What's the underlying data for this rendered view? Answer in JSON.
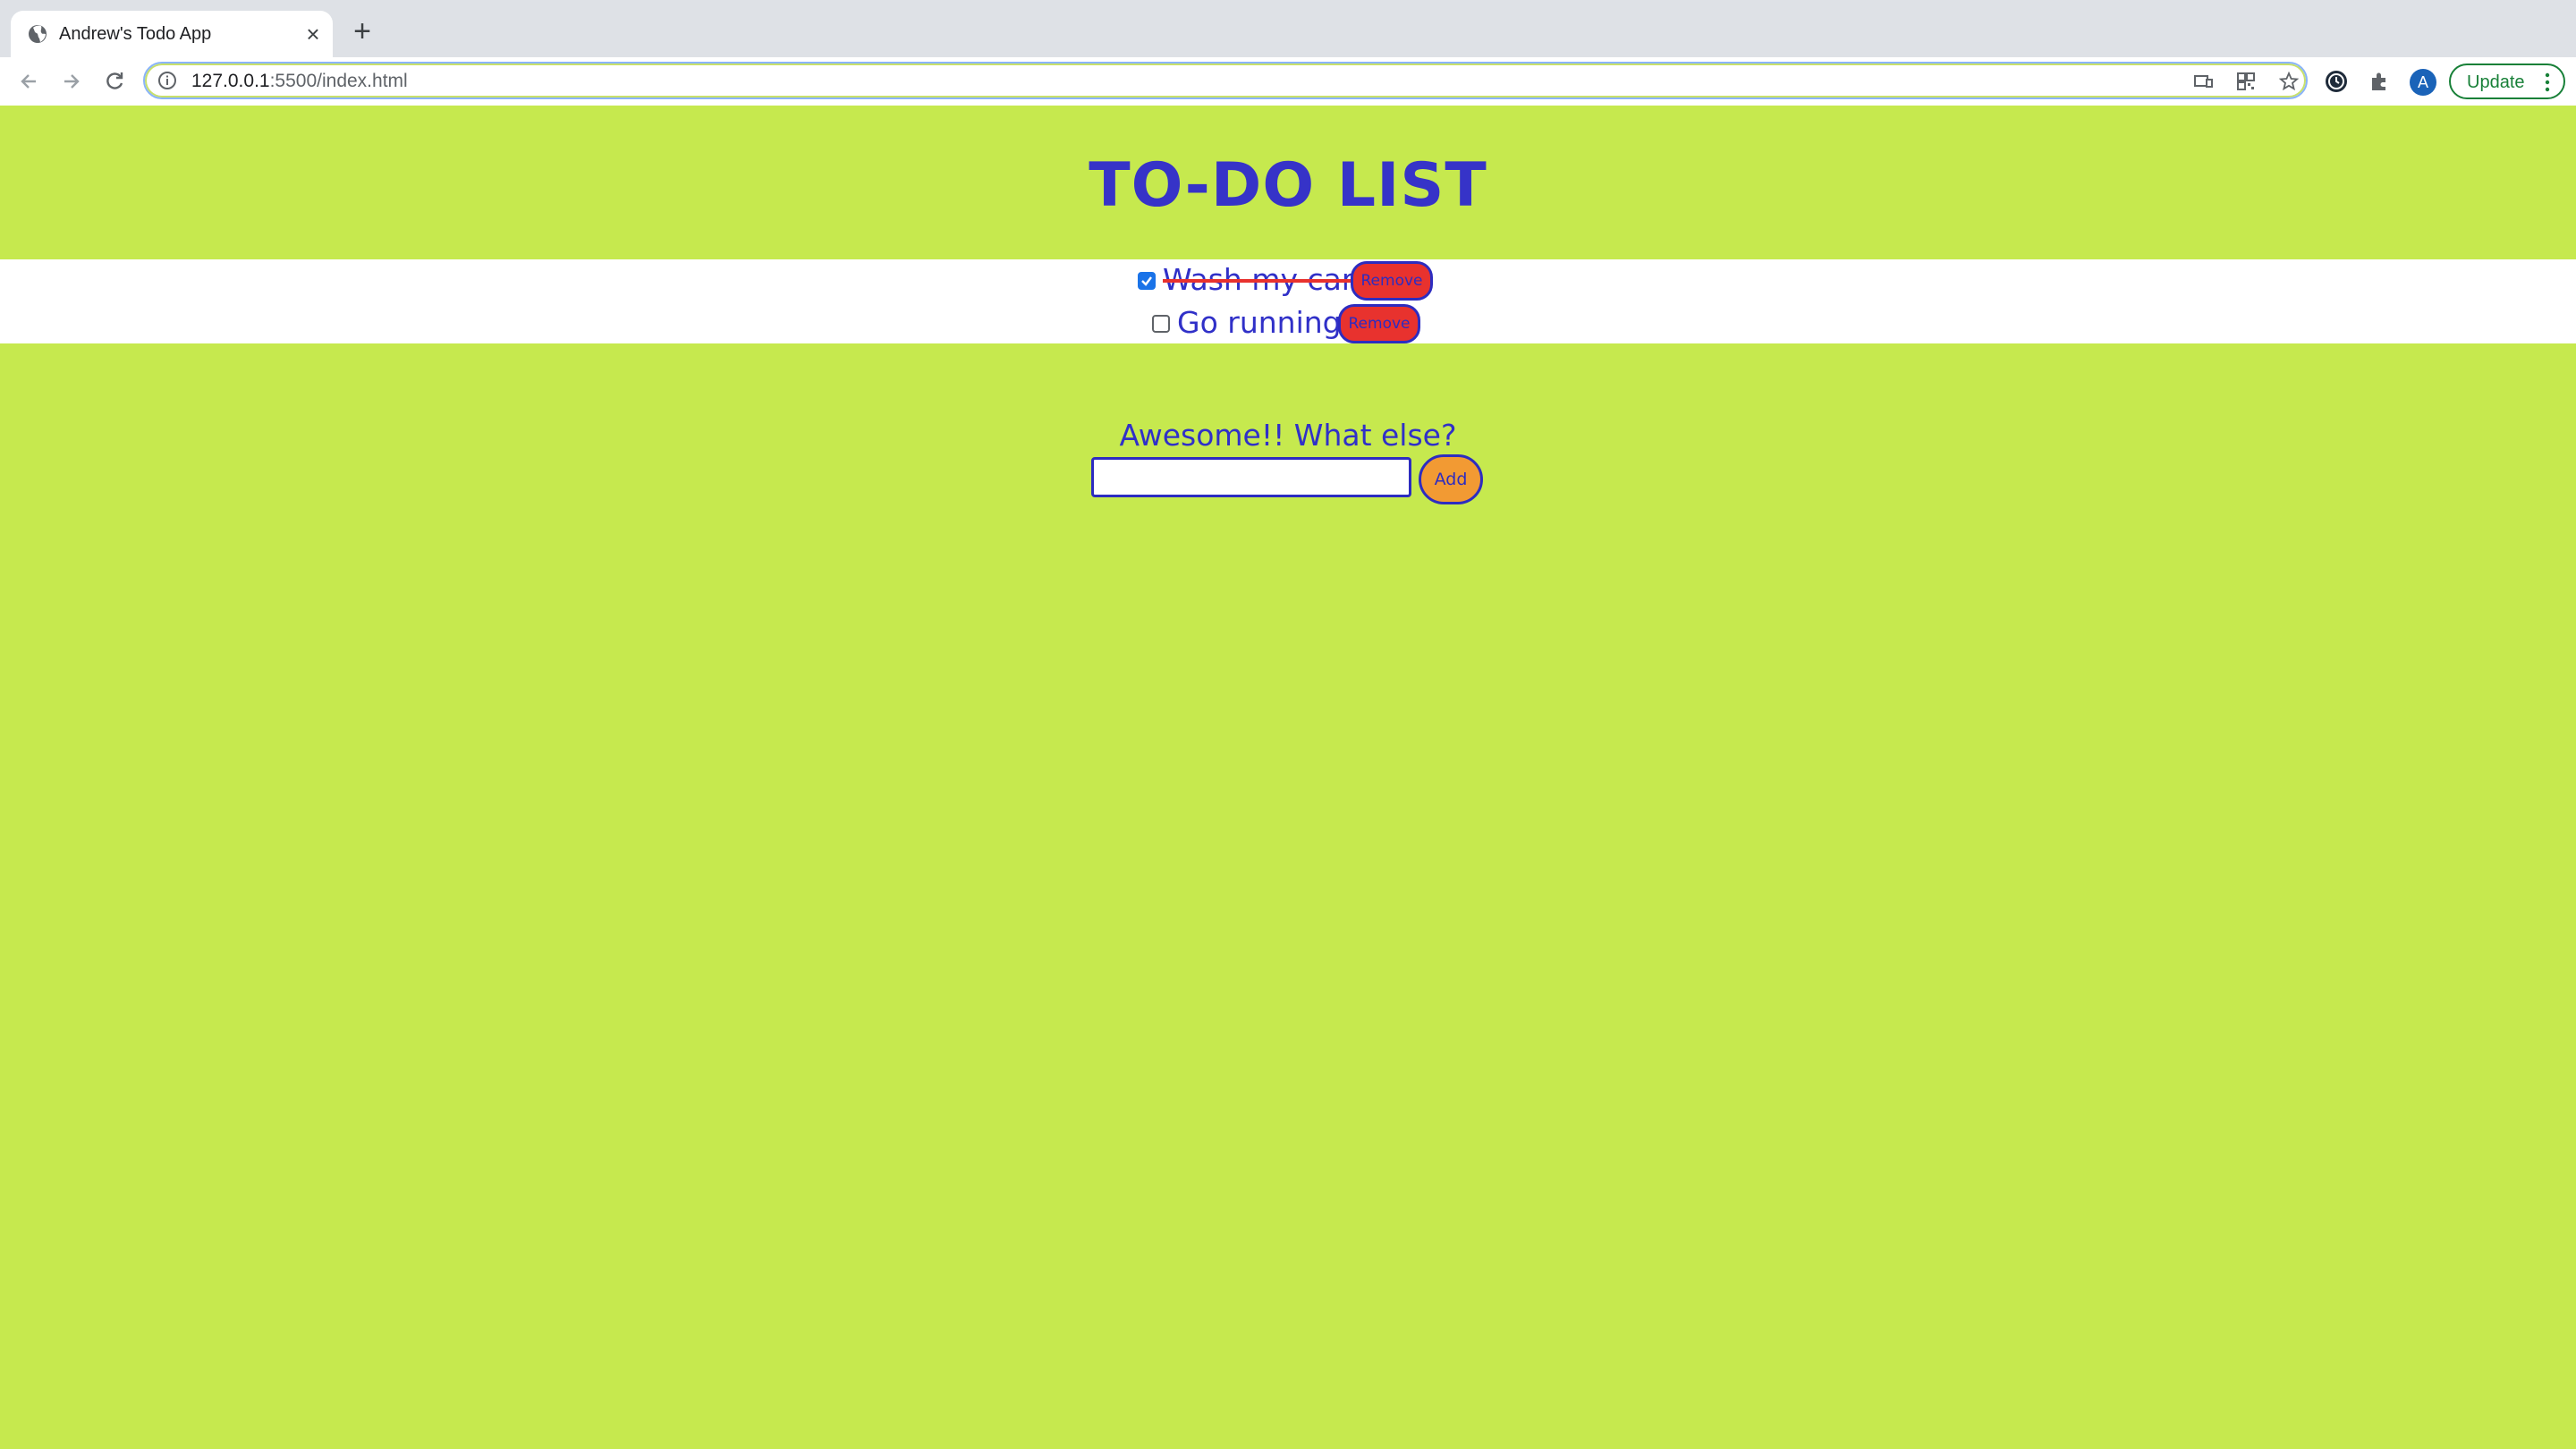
{
  "browser": {
    "tab": {
      "title": "Andrew's Todo App",
      "favicon": "globe-icon",
      "close_icon": "close-icon"
    },
    "new_tab_icon": "plus-icon",
    "address": {
      "url_host": "127.0.0.1",
      "url_rest": ":5500/index.html",
      "info_icon": "info-icon"
    },
    "toolbar_icons": [
      "back-arrow-icon",
      "forward-arrow-icon",
      "reload-icon",
      "cast-icon",
      "qr-code-icon",
      "star-icon",
      "timer-extension-icon",
      "puzzle-extension-icon"
    ],
    "profile_initial": "A",
    "update_label": "Update"
  },
  "page": {
    "title": "TO-DO LIST",
    "todos": [
      {
        "text": "Wash my car",
        "done": true,
        "remove_label": "Remove"
      },
      {
        "text": "Go running",
        "done": false,
        "remove_label": "Remove"
      }
    ],
    "prompt": "Awesome!! What else?",
    "input_value": "",
    "add_label": "Add"
  },
  "colors": {
    "background": "#c6e94e",
    "text": "#3030c8",
    "remove_button": "#e8322e",
    "add_button": "#f29a33",
    "checkbox_checked": "#1a73e8"
  }
}
